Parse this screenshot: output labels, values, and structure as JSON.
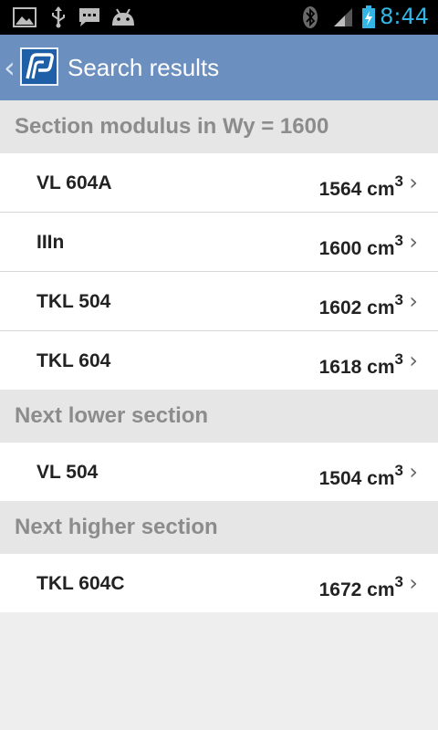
{
  "status_bar": {
    "time": "8:44",
    "icons": [
      "picture-notification-icon",
      "usb-icon",
      "message-icon",
      "android-debug-icon",
      "bluetooth-icon",
      "signal-icon",
      "battery-charging-icon"
    ]
  },
  "action_bar": {
    "back_symbol": "‹",
    "title": "Search results"
  },
  "sections": [
    {
      "header": "Section modulus in Wy = 1600",
      "items": [
        {
          "name": "VL 604A",
          "value": "1564 cm",
          "unit_exponent": "3"
        },
        {
          "name": "IIIn",
          "value": "1600 cm",
          "unit_exponent": "3"
        },
        {
          "name": "TKL 504",
          "value": "1602 cm",
          "unit_exponent": "3"
        },
        {
          "name": "TKL 604",
          "value": "1618 cm",
          "unit_exponent": "3"
        }
      ]
    },
    {
      "header": "Next lower section",
      "items": [
        {
          "name": "VL 504",
          "value": "1504 cm",
          "unit_exponent": "3"
        }
      ]
    },
    {
      "header": "Next higher section",
      "items": [
        {
          "name": "TKL 604C",
          "value": "1672 cm",
          "unit_exponent": "3"
        }
      ]
    }
  ],
  "chevron_symbol": "›",
  "colors": {
    "status_bar": "#000000",
    "action_bar": "#6b8fbf",
    "accent_time": "#33b5e5",
    "section_header_bg": "#e6e6e6",
    "section_header_text": "#8c8c8c",
    "row_bg": "#ffffff",
    "page_bg": "#eeeeee"
  }
}
